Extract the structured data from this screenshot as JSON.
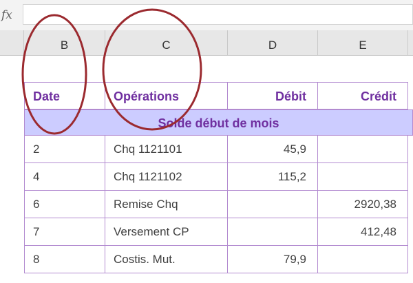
{
  "formula_bar": {
    "fx_label": "fx",
    "content": ""
  },
  "columns": [
    "B",
    "C",
    "D",
    "E"
  ],
  "table": {
    "headers": [
      "Date",
      "Opérations",
      "Débit",
      "Crédit"
    ],
    "banner": "Solde début de mois",
    "rows": [
      [
        "2",
        "Chq 1121101",
        "45,9",
        ""
      ],
      [
        "4",
        "Chq 1121102",
        "115,2",
        ""
      ],
      [
        "6",
        "Remise Chq",
        "",
        "2920,38"
      ],
      [
        "7",
        "Versement CP",
        "",
        "412,48"
      ],
      [
        "8",
        "Costis. Mut.",
        "79,9",
        ""
      ]
    ]
  },
  "colors": {
    "accent": "#7030a0",
    "banner": "#ccccff",
    "grid": "#b28ad0",
    "annotation": "#9b2a2f"
  }
}
